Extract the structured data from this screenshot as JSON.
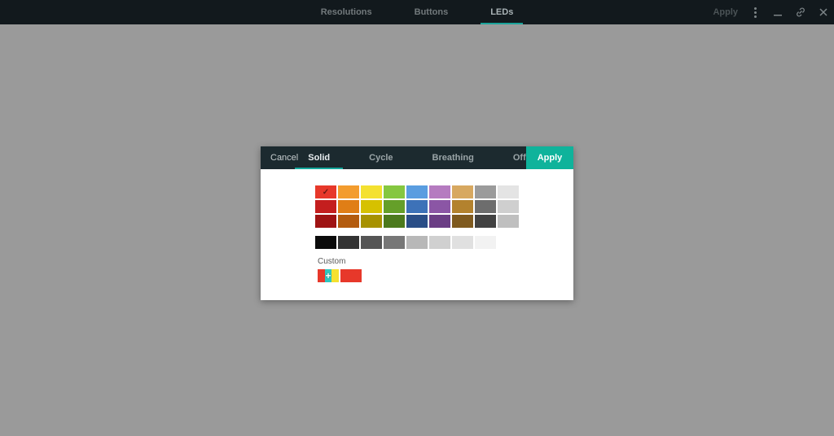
{
  "header": {
    "tabs": [
      {
        "label": "Resolutions"
      },
      {
        "label": "Buttons"
      },
      {
        "label": "LEDs",
        "active": true
      }
    ],
    "apply": "Apply"
  },
  "dialog": {
    "cancel": "Cancel",
    "apply": "Apply",
    "tabs": [
      {
        "label": "Solid",
        "active": true
      },
      {
        "label": "Cycle"
      },
      {
        "label": "Breathing"
      },
      {
        "label": "Off"
      }
    ],
    "custom_label": "Custom",
    "palette": {
      "rows": [
        [
          "#e7382a",
          "#f39c2e",
          "#f4e130",
          "#85c740",
          "#5a9de0",
          "#b57bc0",
          "#d7a860",
          "#9b9b9b",
          "#e4e4e4"
        ],
        [
          "#c41e1e",
          "#e07e16",
          "#d6c100",
          "#659f29",
          "#3d72b8",
          "#8b56a5",
          "#b3822e",
          "#6d6d6d",
          "#cfcfcf"
        ],
        [
          "#9f1313",
          "#b35b0e",
          "#a79200",
          "#4c7a1d",
          "#2a4e87",
          "#6b3e85",
          "#7f5a1f",
          "#424242",
          "#bfbfbf"
        ]
      ],
      "gray_row": [
        "#0b0b0b",
        "#333333",
        "#555555",
        "#777777",
        "#b8b8b8",
        "#d0d0d0",
        "#e0e0e0",
        "#f2f2f2",
        "#ffffff"
      ],
      "selected": {
        "row": 0,
        "index": 0
      }
    },
    "custom_btn_stripes": [
      "#e7382a",
      "#2ec6c0",
      "#f4e130"
    ],
    "custom_swatches": [
      "#e7382a"
    ]
  }
}
